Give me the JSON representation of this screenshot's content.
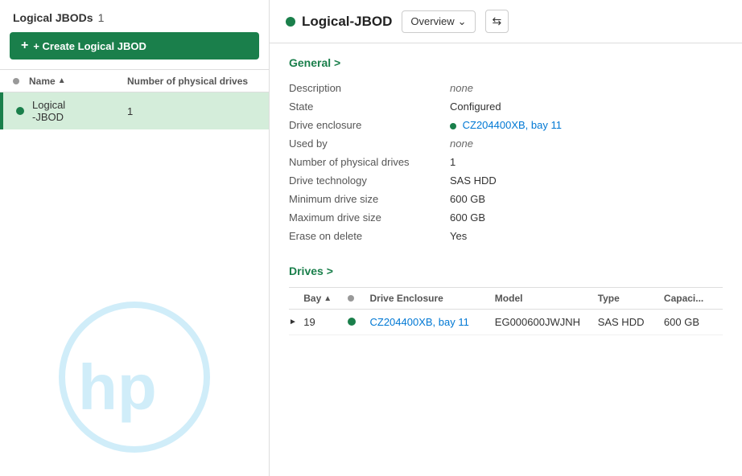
{
  "leftPanel": {
    "title": "Logical JBODs",
    "count": "1",
    "createButton": "+ Create Logical JBOD",
    "tableHeaders": {
      "name": "Name",
      "sortIndicator": "▲",
      "drives": "Number of physical drives"
    },
    "rows": [
      {
        "name": "Logical\n-JBOD",
        "drives": "1",
        "status": "active"
      }
    ]
  },
  "rightPanel": {
    "title": "Logical-JBOD",
    "overviewLabel": "Overview",
    "generalSection": "General >",
    "fields": [
      {
        "label": "Description",
        "value": "none",
        "italic": true,
        "link": false
      },
      {
        "label": "State",
        "value": "Configured",
        "italic": false,
        "link": false
      },
      {
        "label": "Drive enclosure",
        "value": "CZ204400XB, bay 11",
        "italic": false,
        "link": true,
        "dot": true
      },
      {
        "label": "Used by",
        "value": "none",
        "italic": true,
        "link": false
      },
      {
        "label": "Number of physical drives",
        "value": "1",
        "italic": false,
        "link": false
      },
      {
        "label": "Drive technology",
        "value": "SAS HDD",
        "italic": false,
        "link": false
      },
      {
        "label": "Minimum drive size",
        "value": "600 GB",
        "italic": false,
        "link": false
      },
      {
        "label": "Maximum drive size",
        "value": "600 GB",
        "italic": false,
        "link": false
      },
      {
        "label": "Erase on delete",
        "value": "Yes",
        "italic": false,
        "link": false
      }
    ],
    "drivesSection": "Drives >",
    "drivesTableHeaders": {
      "bay": "Bay",
      "sortIndicator": "▲",
      "status": "",
      "enclosure": "Drive Enclosure",
      "model": "Model",
      "type": "Type",
      "capacity": "Capaci..."
    },
    "driveRows": [
      {
        "bay": "19",
        "status": "active",
        "enclosure": "CZ204400XB, bay 11",
        "model": "EG000600JWJNH",
        "type": "SAS HDD",
        "capacity": "600 GB"
      }
    ]
  }
}
